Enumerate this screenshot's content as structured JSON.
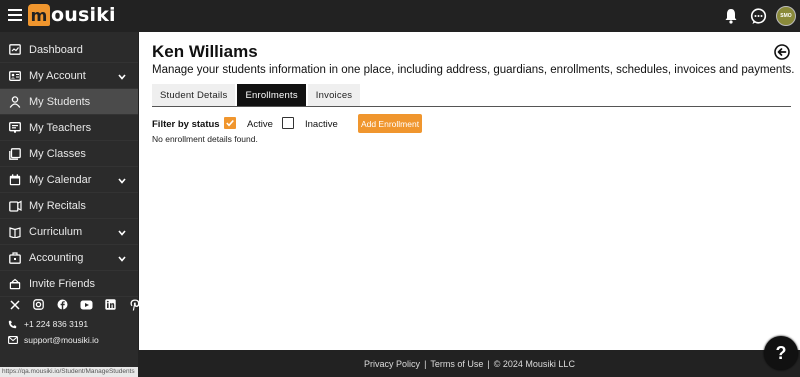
{
  "app": {
    "logo_text": "ousiki",
    "logo_mark": "m",
    "avatar_initials": "SMO"
  },
  "sidebar": {
    "items": [
      {
        "label": "Dashboard",
        "icon": "dashboard-icon",
        "has_chevron": false
      },
      {
        "label": "My Account",
        "icon": "account-icon",
        "has_chevron": true
      },
      {
        "label": "My Students",
        "icon": "person-icon",
        "has_chevron": false,
        "active": true
      },
      {
        "label": "My Teachers",
        "icon": "teacher-icon",
        "has_chevron": false
      },
      {
        "label": "My Classes",
        "icon": "classes-icon",
        "has_chevron": false
      },
      {
        "label": "My Calendar",
        "icon": "calendar-icon",
        "has_chevron": true
      },
      {
        "label": "My Recitals",
        "icon": "recitals-icon",
        "has_chevron": false
      },
      {
        "label": "Curriculum",
        "icon": "curriculum-icon",
        "has_chevron": true
      },
      {
        "label": "Accounting",
        "icon": "accounting-icon",
        "has_chevron": true
      },
      {
        "label": "Invite Friends",
        "icon": "gift-icon",
        "has_chevron": false
      }
    ],
    "phone": "+1 224 836 3191",
    "email": "support@mousiki.io",
    "status_url": "https://qa.mousiki.io/Student/ManageStudents"
  },
  "main": {
    "title": "Ken Williams",
    "subtitle": "Manage your students information in one place, including address, guardians, enrollments, schedules, invoices and payments.",
    "tabs": [
      {
        "label": "Student Details",
        "active": false
      },
      {
        "label": "Enrollments",
        "active": true
      },
      {
        "label": "Invoices",
        "active": false
      }
    ],
    "filter_label": "Filter by status",
    "filter_active_label": "Active",
    "filter_active_checked": true,
    "filter_inactive_label": "Inactive",
    "filter_inactive_checked": false,
    "add_button": "Add Enrollment",
    "empty_message": "No enrollment details found."
  },
  "footer": {
    "privacy": "Privacy Policy",
    "terms": "Terms of Use",
    "copyright": "© 2024 Mousiki LLC",
    "separator": "|"
  },
  "help_label": "?",
  "colors": {
    "accent": "#f0962e",
    "topbar": "#222222",
    "sidebar": "#2b2b2b",
    "active_item": "#4b4b4b"
  }
}
